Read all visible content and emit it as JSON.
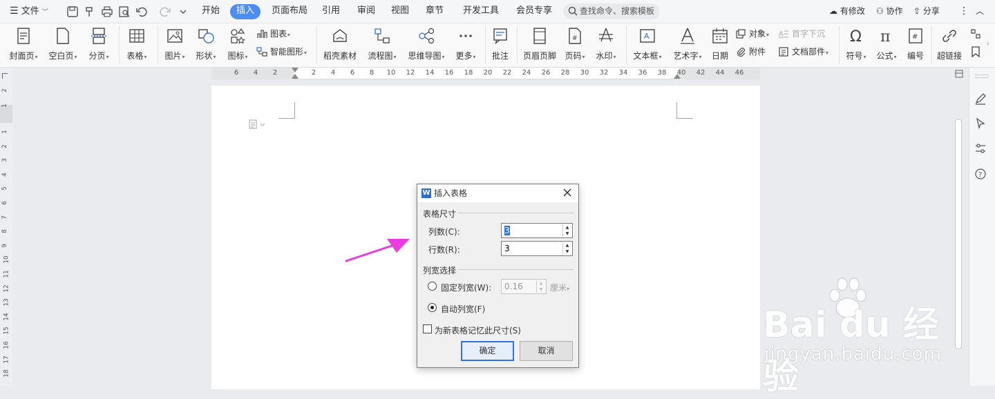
{
  "titlebar": {
    "menu_label": "文件",
    "tabs": [
      "开始",
      "插入",
      "页面布局",
      "引用",
      "审阅",
      "视图",
      "章节",
      "开发工具",
      "会员专享"
    ],
    "active_tab": "插入",
    "search_placeholder": "查找命令、搜索模板",
    "changes_label": "有修改",
    "collab_label": "协作",
    "share_label": "分享"
  },
  "toolbar": {
    "cover": "封面页",
    "blank": "空白页",
    "pagebreak": "分页",
    "table": "表格",
    "picture": "图片",
    "shape": "形状",
    "icon": "图标",
    "chart": "图表",
    "smartart": "智能图形",
    "daoke": "稻壳素材",
    "flowchart": "流程图",
    "mindmap": "思维导图",
    "more": "更多",
    "comment": "批注",
    "header_footer": "页眉页脚",
    "page_number": "页码",
    "watermark": "水印",
    "textbox": "文本框",
    "wordart": "艺术字",
    "date": "日期",
    "object": "对象",
    "attachment": "附件",
    "dropcap": "首字下沉",
    "docpart": "文档部件",
    "symbol": "符号",
    "formula": "公式",
    "numbering": "编号",
    "hyperlink": "超链接"
  },
  "ruler": {
    "h_numbers": [
      "6",
      "4",
      "2",
      "2",
      "4",
      "6",
      "8",
      "10",
      "12",
      "14",
      "16",
      "18",
      "20",
      "22",
      "24",
      "26",
      "28",
      "30",
      "32",
      "34",
      "36",
      "38",
      "40",
      "42",
      "44",
      "46"
    ],
    "v_numbers": [
      "2",
      "1",
      "1",
      "2",
      "3",
      "4",
      "5",
      "6",
      "7",
      "8",
      "9",
      "10",
      "11",
      "12",
      "13",
      "14",
      "15",
      "16",
      "17",
      "18"
    ]
  },
  "dialog": {
    "title": "插入表格",
    "size_group": "表格尺寸",
    "columns_label": "列数(C):",
    "columns_value": "3",
    "rows_label": "行数(R):",
    "rows_value": "3",
    "width_group": "列宽选择",
    "fixed_label": "固定列宽(W):",
    "fixed_value": "0.16",
    "fixed_unit": "厘米",
    "auto_label": "自动列宽(F)",
    "remember_label": "为新表格记忆此尺寸(S)",
    "ok_label": "确定",
    "cancel_label": "取消",
    "auto_selected": true,
    "remember_checked": false
  },
  "watermark": {
    "line1": "Bai du 经验",
    "line2": "jingyan.baidu.com"
  },
  "colors": {
    "accent": "#4d8cf0",
    "arrow": "#e83ce0"
  }
}
